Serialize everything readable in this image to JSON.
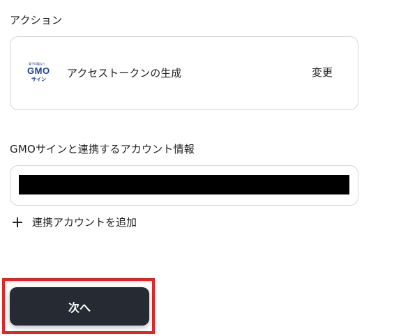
{
  "action_section": {
    "title": "アクション",
    "card": {
      "logo": {
        "tagline": "電子印鑑なら",
        "brand": "GMO",
        "sub": "サイン"
      },
      "action_name": "アクセストークンの生成",
      "change_label": "変更"
    }
  },
  "account_section": {
    "title": "GMOサインと連携するアカウント情報",
    "selected_value_redacted": true,
    "add_account_label": "連携アカウントを追加"
  },
  "footer": {
    "next_label": "次へ",
    "highlight_color": "#e02626",
    "button_color": "#262b33"
  }
}
